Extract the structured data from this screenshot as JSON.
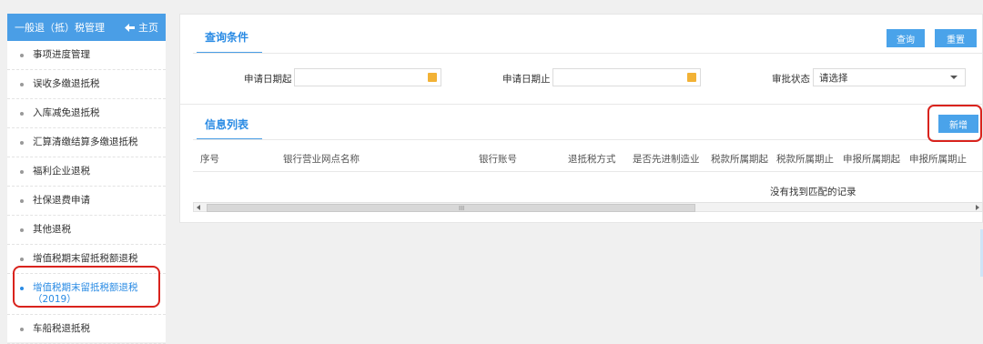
{
  "sidebar": {
    "title": "一般退（抵）税管理",
    "home_label": "主页",
    "items": [
      {
        "label": "事项进度管理"
      },
      {
        "label": "误收多缴退抵税"
      },
      {
        "label": "入库减免退抵税"
      },
      {
        "label": "汇算清缴结算多缴退抵税"
      },
      {
        "label": "福利企业退税"
      },
      {
        "label": "社保退费申请"
      },
      {
        "label": "其他退税"
      },
      {
        "label": "增值税期末留抵税额退税"
      },
      {
        "label": "增值税期末留抵税额退税\n（2019）"
      },
      {
        "label": "车船税退抵税"
      }
    ]
  },
  "query": {
    "title": "查询条件",
    "search_label": "查询",
    "reset_label": "重置",
    "start_date_label": "申请日期起",
    "end_date_label": "申请日期止",
    "status_label": "审批状态",
    "status_value": "请选择"
  },
  "list": {
    "title": "信息列表",
    "add_label": "新增",
    "columns": [
      "序号",
      "银行营业网点名称",
      "银行账号",
      "退抵税方式",
      "是否先进制造业",
      "税款所属期起",
      "税款所属期止",
      "申报所属期起",
      "申报所属期止"
    ],
    "empty_text": "没有找到匹配的记录",
    "scroll_grip": "III"
  },
  "colors": {
    "accent": "#4a9ee6",
    "highlight": "#d9231d",
    "calendar": "#f2b236"
  }
}
